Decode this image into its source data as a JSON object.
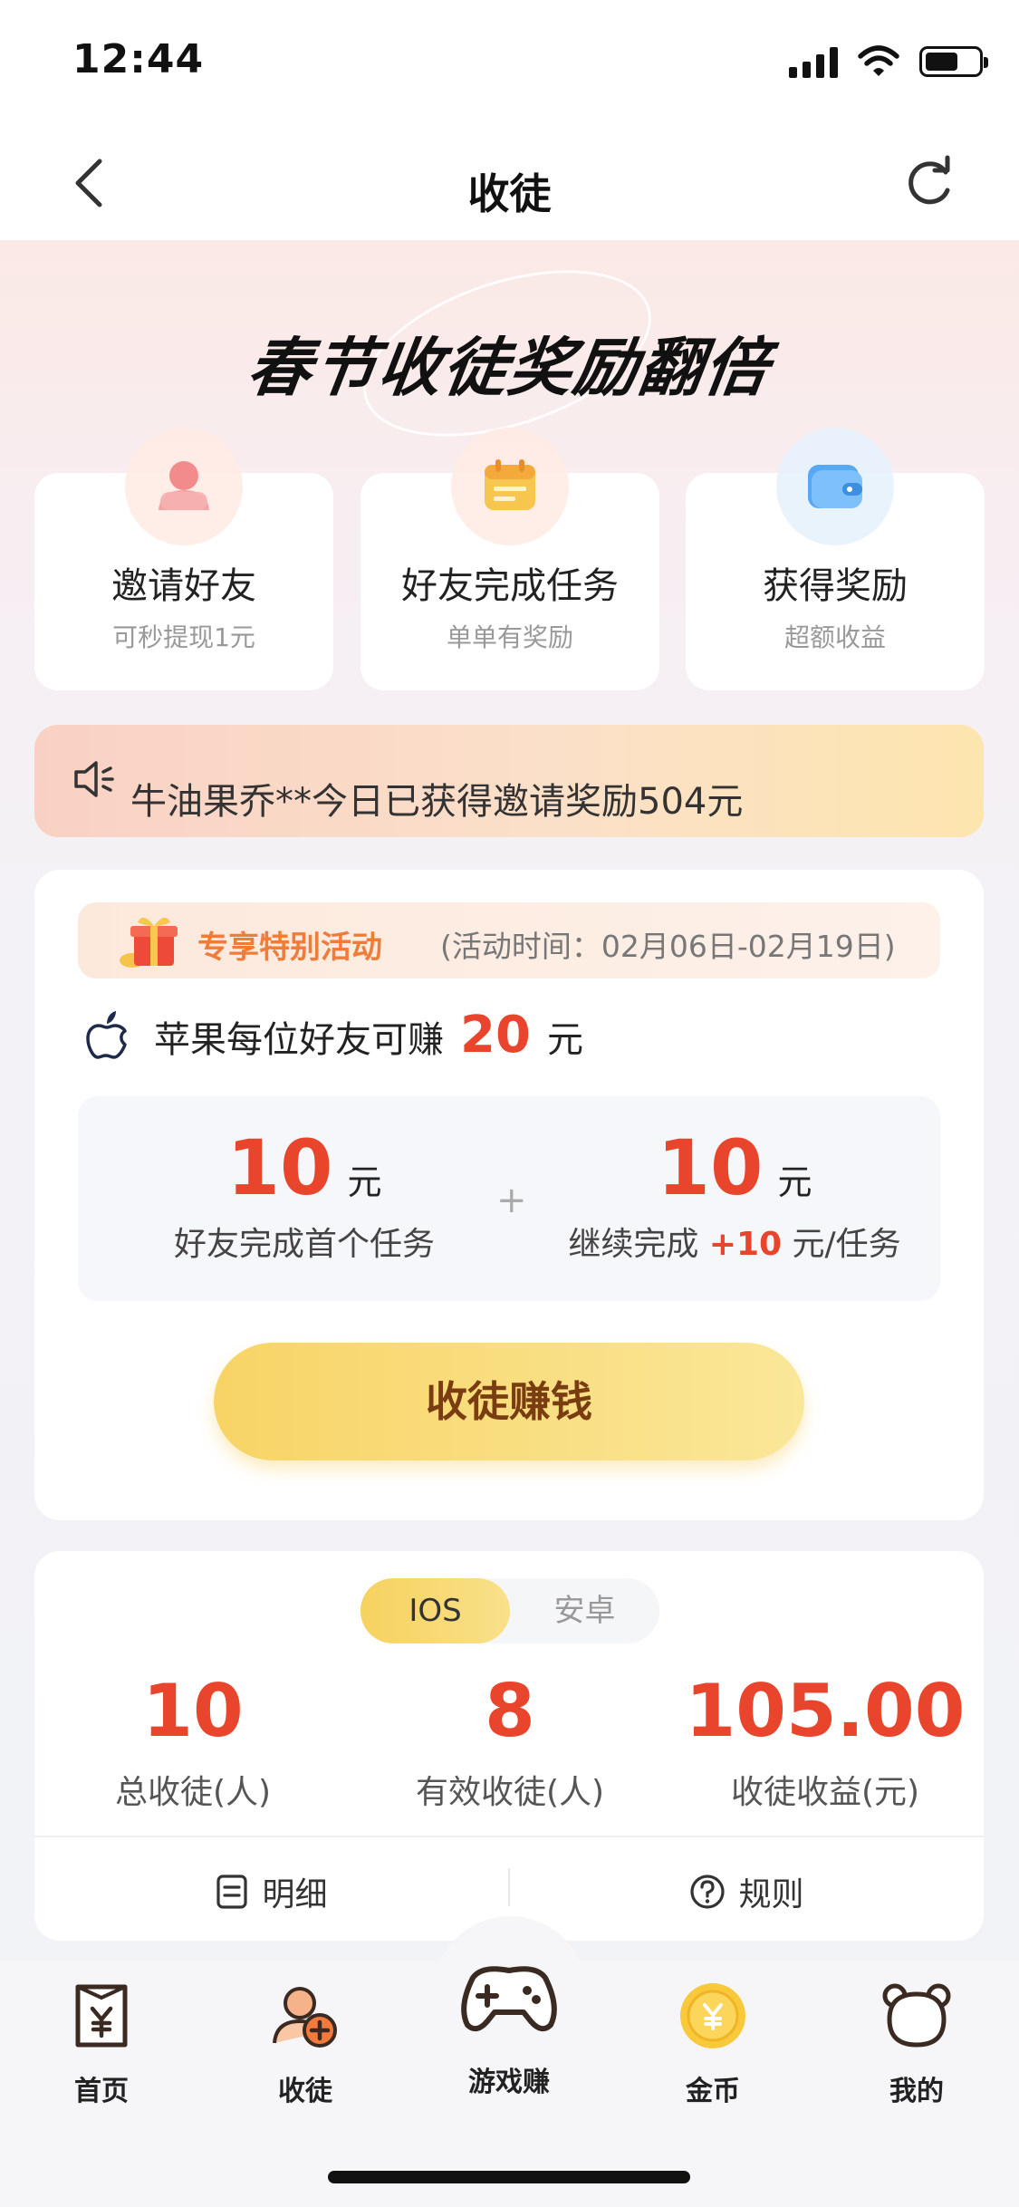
{
  "status_bar": {
    "time": "12:44",
    "battery_level": 0.62
  },
  "nav": {
    "title": "收徒",
    "back_icon": "chevron-left-icon",
    "refresh_icon": "refresh-icon"
  },
  "banner": {
    "title": "春节收徒奖励翻倍"
  },
  "steps": [
    {
      "title": "邀请好友",
      "subtitle": "可秒提现1元",
      "icon": "person-icon"
    },
    {
      "title": "好友完成任务",
      "subtitle": "单单有奖励",
      "icon": "calendar-icon"
    },
    {
      "title": "获得奖励",
      "subtitle": "超额收益",
      "icon": "wallet-icon"
    }
  ],
  "ticker": {
    "icon": "speaker-icon",
    "text": "牛油果乔**今日已获得邀请奖励504元"
  },
  "activity": {
    "promo_title": "专享特别活动",
    "promo_time": "(活动时间：02月06日-02月19日)",
    "apple_prefix": "苹果每位好友可赚",
    "apple_amount": "20",
    "apple_unit": "元",
    "reward_left": {
      "amount": "10",
      "unit": "元",
      "desc": "好友完成首个任务"
    },
    "plus": "+",
    "reward_right": {
      "amount": "10",
      "unit": "元",
      "desc_prefix": "继续完成",
      "desc_highlight": "+10",
      "desc_suffix": "元/任务"
    },
    "cta": "收徒赚钱"
  },
  "stats": {
    "tabs": [
      "IOS",
      "安卓"
    ],
    "active_tab": "IOS",
    "items": [
      {
        "value": "10",
        "label": "总收徒(人)"
      },
      {
        "value": "8",
        "label": "有效收徒(人)"
      },
      {
        "value": "105.00",
        "label": "收徒收益(元)"
      }
    ],
    "links": [
      {
        "label": "明细",
        "icon": "list-icon"
      },
      {
        "label": "规则",
        "icon": "question-icon"
      }
    ]
  },
  "tab_bar": [
    {
      "label": "首页",
      "icon": "yen-card-icon"
    },
    {
      "label": "收徒",
      "icon": "add-user-icon"
    },
    {
      "label": "游戏赚",
      "icon": "gamepad-icon"
    },
    {
      "label": "金币",
      "icon": "coin-icon"
    },
    {
      "label": "我的",
      "icon": "bear-icon"
    }
  ],
  "colors": {
    "accent_red": "#e8452c",
    "accent_orange": "#f07c3a",
    "cta_yellow": "#f8d466"
  }
}
